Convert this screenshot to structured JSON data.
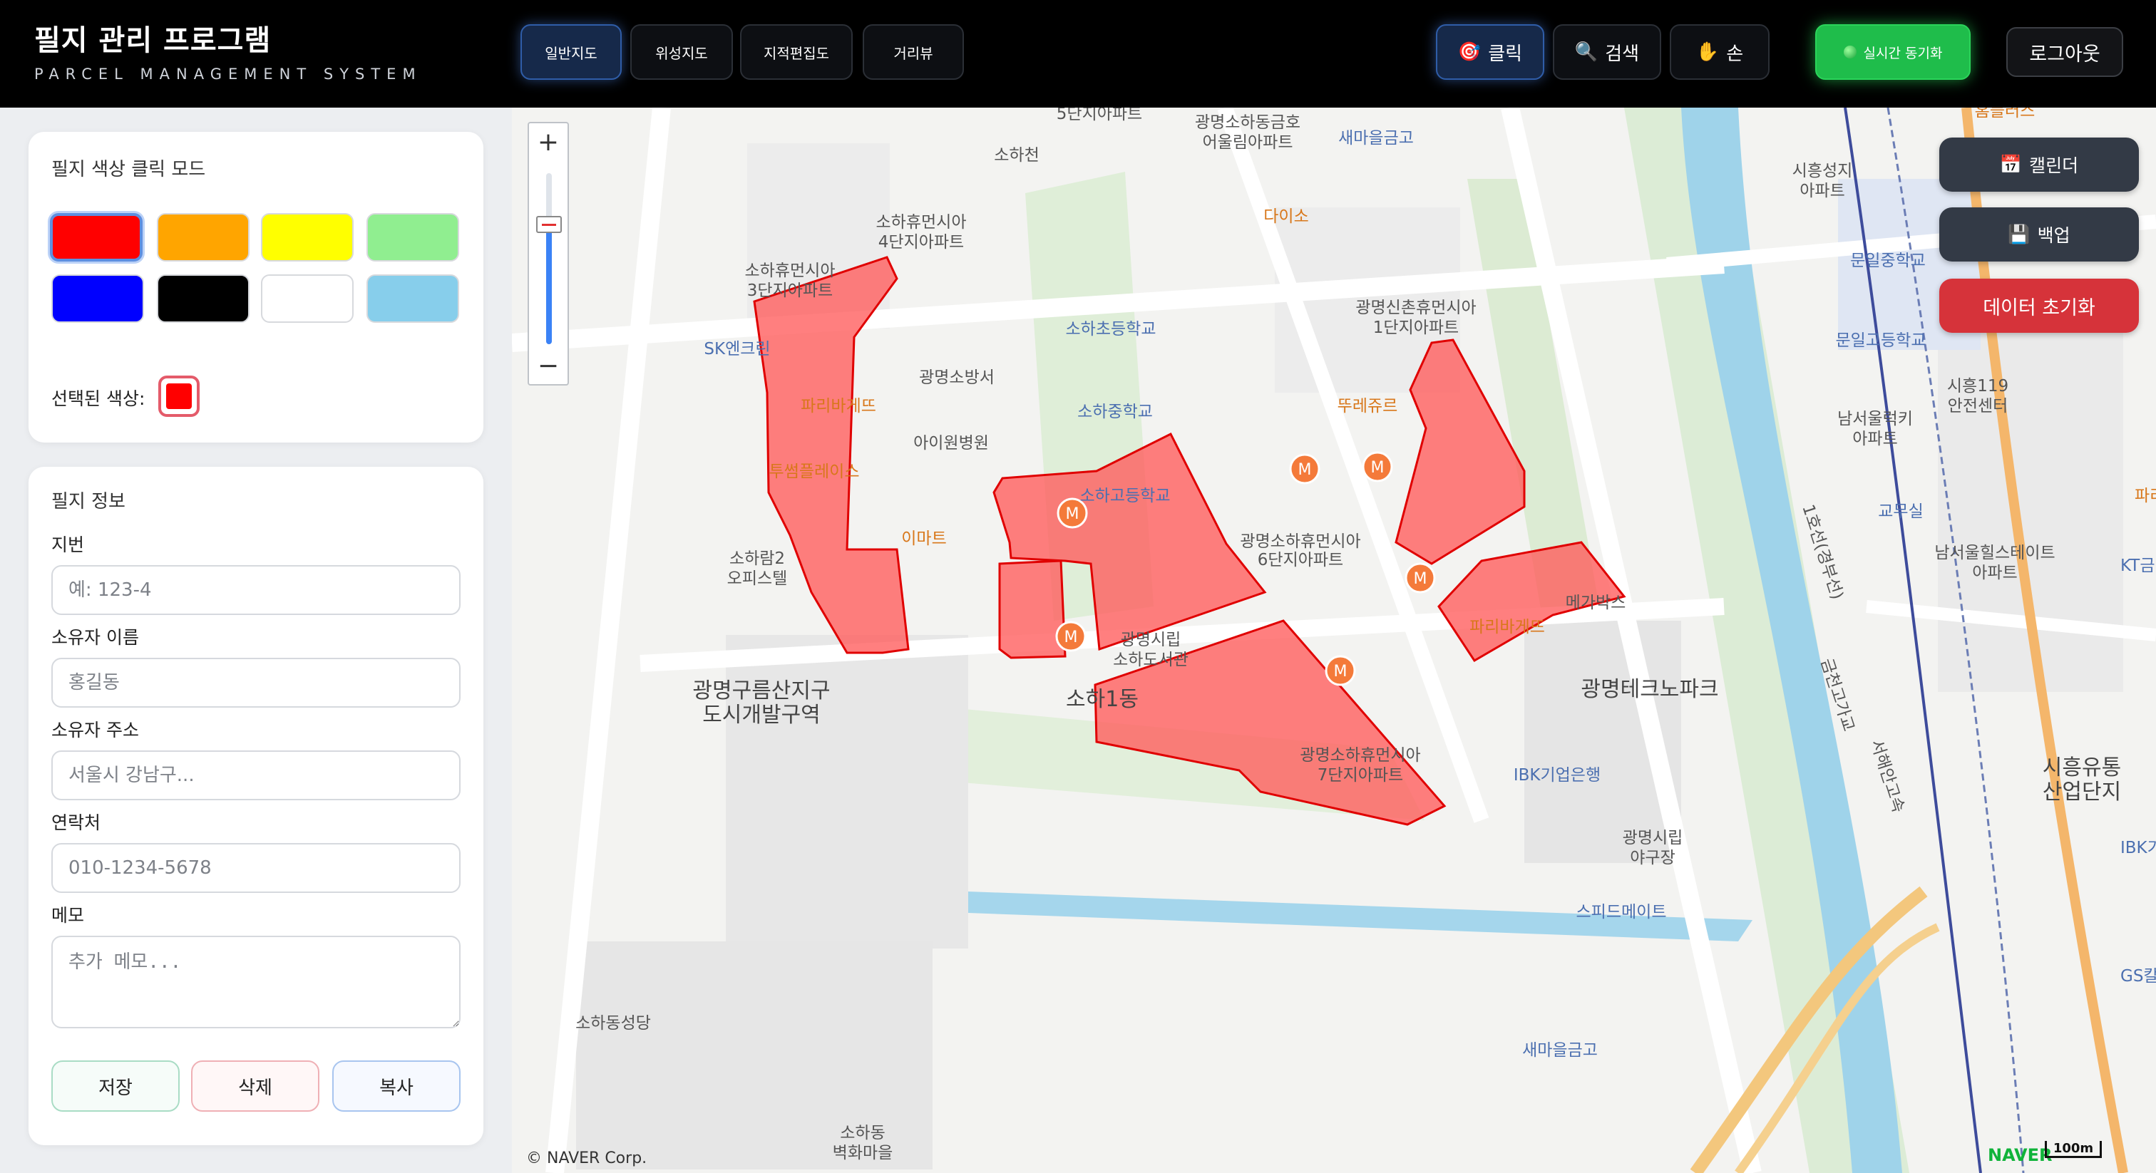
{
  "header": {
    "title": "필지 관리 프로그램",
    "subtitle": "PARCEL MANAGEMENT SYSTEM",
    "map_tabs": [
      {
        "label": "일반지도",
        "active": true
      },
      {
        "label": "위성지도",
        "active": false
      },
      {
        "label": "지적편집도",
        "active": false
      },
      {
        "label": "거리뷰",
        "active": false
      }
    ],
    "modes": [
      {
        "label": "클릭",
        "icon": "target-icon",
        "active": true
      },
      {
        "label": "검색",
        "icon": "search-icon",
        "active": false
      },
      {
        "label": "손",
        "icon": "hand-icon",
        "active": false
      }
    ],
    "sync_label": "실시간 동기화",
    "logout_label": "로그아웃"
  },
  "color_panel": {
    "title": "필지 색상 클릭 모드",
    "colors": [
      "#ff0000",
      "#ffa500",
      "#ffff00",
      "#90ee90",
      "#0000ff",
      "#000000",
      "#ffffff",
      "#87ceeb"
    ],
    "selected_label": "선택된 색상:",
    "selected_color": "#ff0000"
  },
  "info_panel": {
    "title": "필지 정보",
    "fields": [
      {
        "label": "지번",
        "placeholder": "예: 123-4",
        "value": ""
      },
      {
        "label": "소유자 이름",
        "placeholder": "홍길동",
        "value": ""
      },
      {
        "label": "소유자 주소",
        "placeholder": "서울시 강남구...",
        "value": ""
      },
      {
        "label": "연락처",
        "placeholder": "010-1234-5678",
        "value": ""
      }
    ],
    "memo_label": "메모",
    "memo_placeholder": "추가 메모...",
    "buttons": {
      "save": "저장",
      "delete": "삭제",
      "copy": "복사"
    }
  },
  "map": {
    "zoom_in": "+",
    "zoom_out": "−",
    "zoom_level_fraction": 0.7,
    "side_buttons": {
      "calendar": "캘린더",
      "backup": "백업",
      "reset": "데이터 초기화"
    },
    "copyright": "© NAVER Corp.",
    "naver_logo": "NAVER",
    "scale": "100m",
    "labels": {
      "l1": "5단지아파트",
      "l2": "광명소하동금호",
      "l3": "어울림아파트",
      "l4": "새마을금고",
      "l5": "소하천",
      "l6": "소하휴먼시아",
      "l7": "4단지아파트",
      "l8": "다이소",
      "l9": "소하휴먼시아",
      "l10": "3단지아파트",
      "l11": "광명신촌휴먼시아",
      "l12": "1단지아파트",
      "l13": "SK엔크린",
      "l14": "소하초등학교",
      "l15": "광명소방서",
      "l16": "파리바게뜨",
      "l17": "뚜레쥬르",
      "l18": "아이원병원",
      "l19": "소하중학교",
      "l20": "투썸플레이스",
      "l21": "소하고등학교",
      "l22": "이마트",
      "l23": "소하람2",
      "l24": "오피스텔",
      "l25": "광명소하휴먼시아",
      "l26": "6단지아파트",
      "l27": "메가박스",
      "l28": "파리바게뜨",
      "l29": "광명시립",
      "l30": "소하도서관",
      "l31": "광명구름산지구",
      "l32": "도시개발구역",
      "l33": "소하1동",
      "l34": "광명테크노파크",
      "l35": "광명소하휴먼시아",
      "l36": "7단지아파트",
      "l37": "IBK기업은행",
      "l38": "광명시립",
      "l39": "야구장",
      "l40": "스피드메이트",
      "l41": "소하동성당",
      "l42": "새마을금고",
      "l43": "소하동",
      "l44": "벽화마을",
      "l45": "시흥성지",
      "l46": "아파트",
      "l47": "문일중학교",
      "l48": "문일고등학교",
      "l49": "시흥119",
      "l50": "안전센터",
      "l51": "남서울럭키",
      "l52": "아파트",
      "l53": "교무실",
      "l54": "남서울힐스테이트",
      "l55": "아파트",
      "l56": "시흥유통",
      "l57": "산업단지",
      "l58": "1호선(경부선)",
      "l59": "서해안고속",
      "l60": "금천고가교",
      "l61": "홈플러스",
      "l62": "파리바",
      "l63": "KT금",
      "l64": "GS칼",
      "l65": "IBK기"
    }
  }
}
